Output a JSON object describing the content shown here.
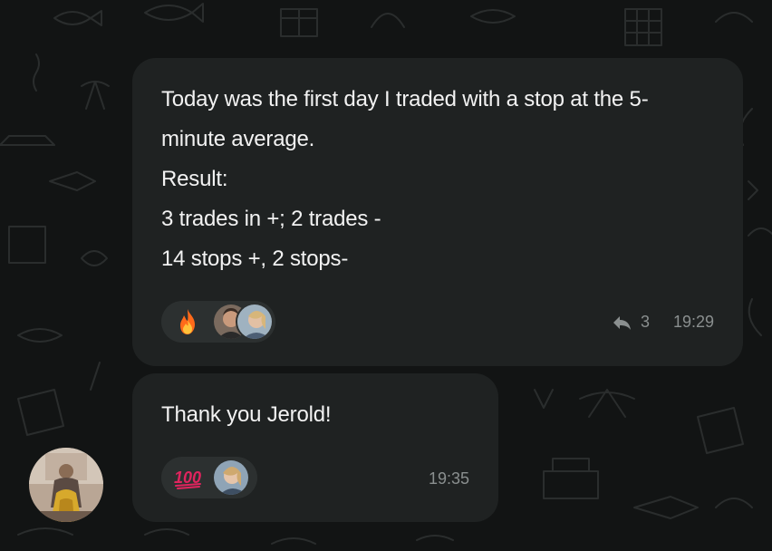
{
  "messages": [
    {
      "lines": [
        "Today was the first day I traded with a stop at the 5-",
        "minute average.",
        "Result:",
        "3 trades in +; 2 trades -",
        "14 stops +, 2 stops-"
      ],
      "reaction_emoji": "fire",
      "reply_count": "3",
      "time": "19:29",
      "reply_icon": "reply-arrow-icon"
    },
    {
      "lines": [
        "Thank you Jerold!"
      ],
      "reaction_emoji": "hundred-points",
      "time": "19:35"
    }
  ],
  "colors": {
    "background": "#121414",
    "bubble": "#1f2222",
    "reaction_pill": "#2c3030",
    "text": "#f2f2f2",
    "meta": "#8a8f8f",
    "hundred": "#e0245e"
  }
}
